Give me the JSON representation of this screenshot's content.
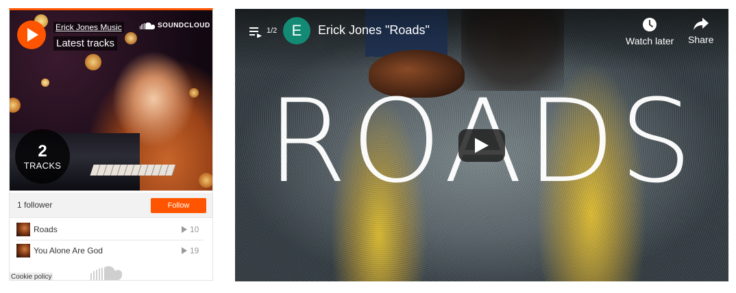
{
  "soundcloud": {
    "artist": "Erick Jones Music",
    "heading": "Latest tracks",
    "logo_text": "SOUNDCLOUD",
    "track_count": "2",
    "track_count_label": "TRACKS",
    "followers": "1 follower",
    "follow_label": "Follow",
    "tracks": [
      {
        "name": "Roads",
        "plays": "10"
      },
      {
        "name": "You Alone Are God",
        "plays": "19"
      }
    ],
    "cookie_policy": "Cookie policy",
    "accent_color": "#ff5500"
  },
  "youtube": {
    "playlist_position": "1/2",
    "channel_initial": "E",
    "video_title": "Erick Jones \"Roads\"",
    "watch_later_label": "Watch later",
    "share_label": "Share",
    "thumbnail_text": "ROADS",
    "avatar_color": "#138a74"
  }
}
